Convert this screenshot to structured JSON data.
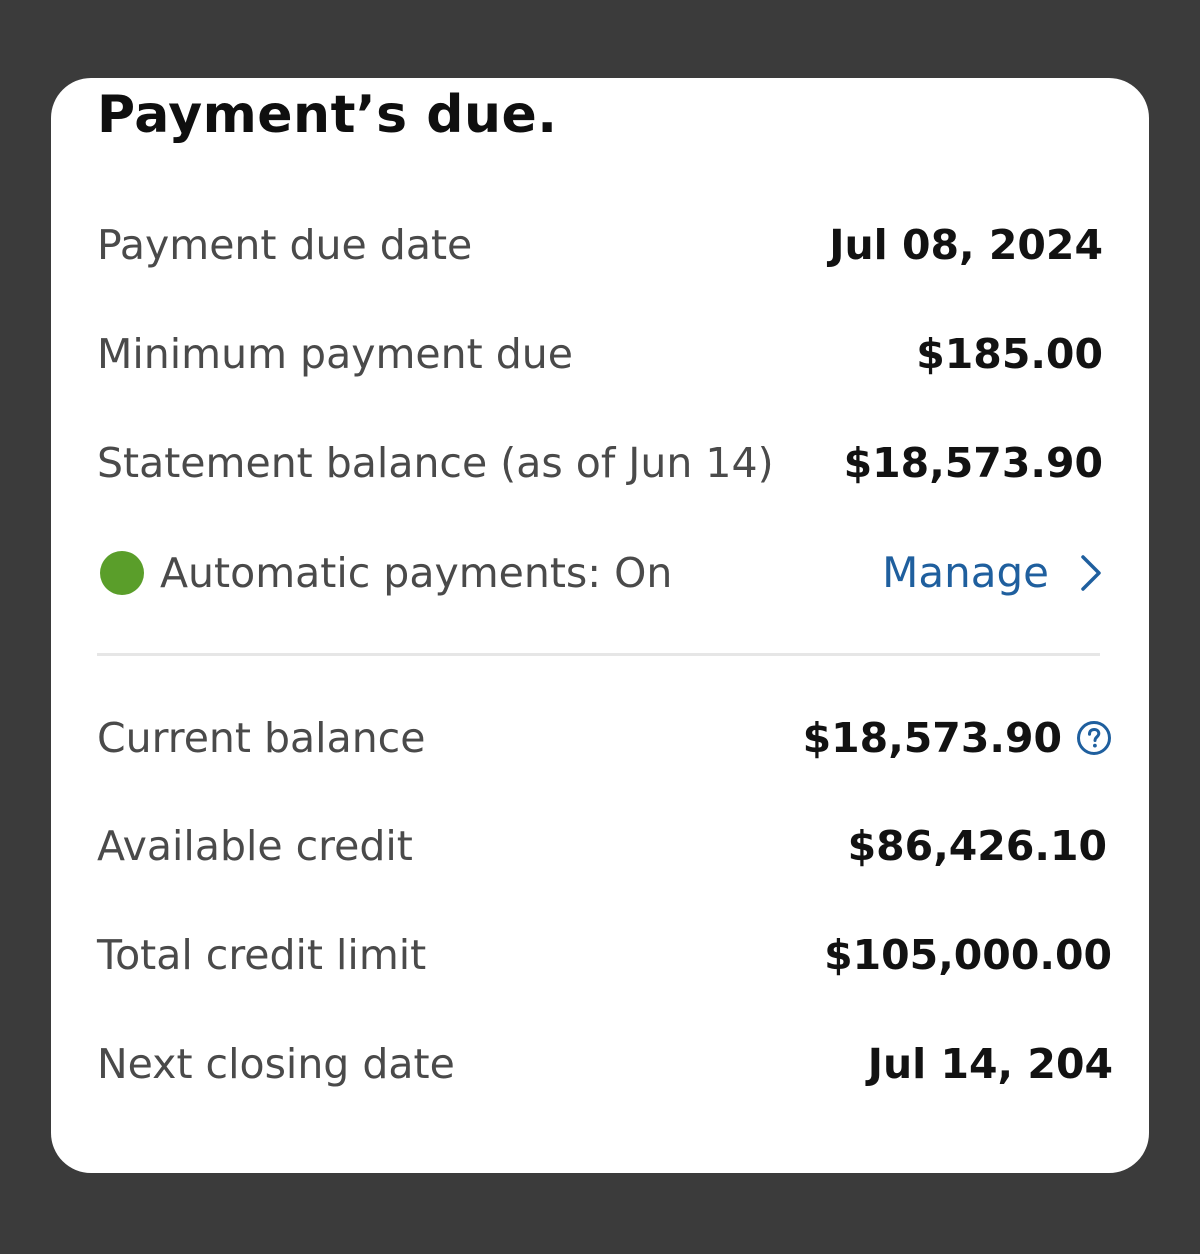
{
  "title": "Payment’s due.",
  "payment_due_date": {
    "label": "Payment due date",
    "value": "Jul 08, 2024"
  },
  "minimum_payment": {
    "label": "Minimum payment due",
    "value": "$185.00"
  },
  "statement_balance": {
    "label": "Statement balance (as of Jun 14)",
    "value": "$18,573.90"
  },
  "autopay": {
    "label": "Automatic payments: On",
    "link_label": "Manage",
    "status_color": "#5a9e2a",
    "link_color": "#1f5f9e"
  },
  "current_balance": {
    "label": "Current balance",
    "value": "$18,573.90",
    "help_icon": "question-circle-icon"
  },
  "available_credit": {
    "label": "Available credit",
    "value": "$86,426.10"
  },
  "total_credit_limit": {
    "label": "Total credit limit",
    "value": "$105,000.00"
  },
  "next_closing_date": {
    "label": "Next closing date",
    "value": "Jul 14, 204"
  }
}
